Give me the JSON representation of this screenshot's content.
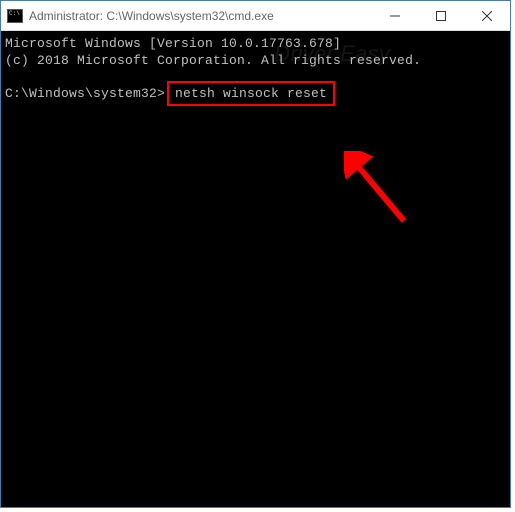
{
  "titlebar": {
    "title": "Administrator: C:\\Windows\\system32\\cmd.exe"
  },
  "terminal": {
    "line1": "Microsoft Windows [Version 10.0.17763.678]",
    "line2": "(c) 2018 Microsoft Corporation. All rights reserved.",
    "prompt": "C:\\Windows\\system32>",
    "command": "netsh winsock reset"
  },
  "watermark": "Driver Easy",
  "annotation": {
    "highlight_color": "#ff0000",
    "arrow_color": "#ff0000"
  }
}
